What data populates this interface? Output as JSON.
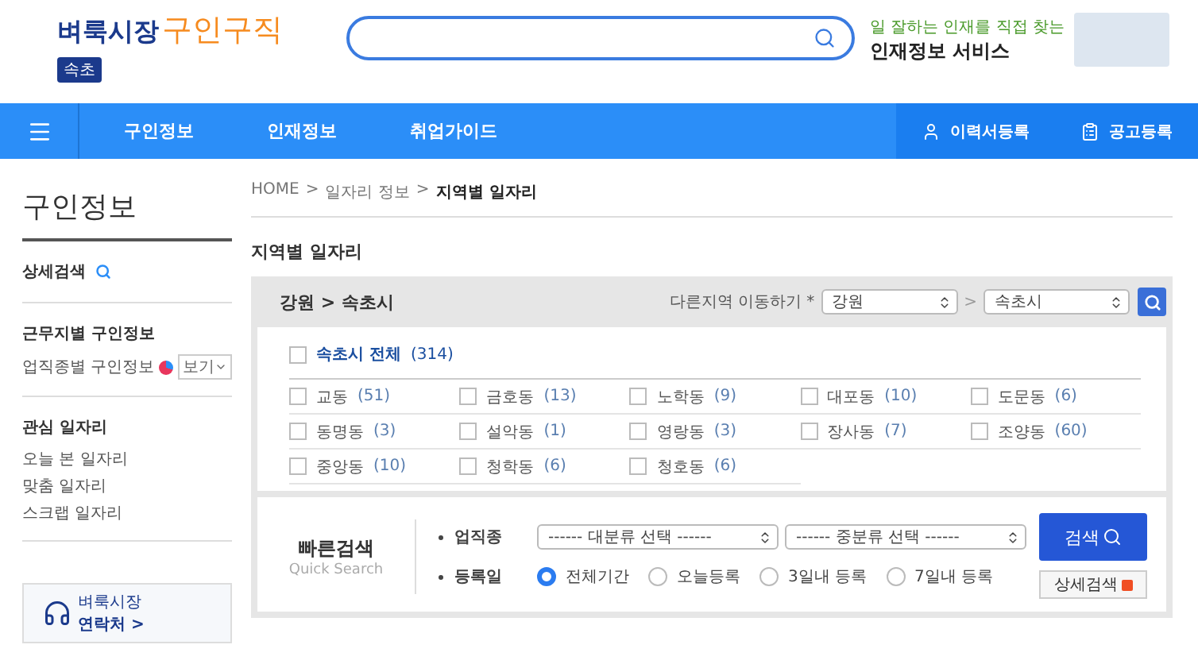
{
  "header": {
    "logo": {
      "brand": "벼룩시장",
      "service": "구인구직"
    },
    "region_badge": "속초",
    "ad": {
      "tagline": "일 잘하는 인재를 직접 찾는",
      "title": "인재정보 서비스"
    }
  },
  "nav": {
    "items": [
      {
        "label": "구인정보"
      },
      {
        "label": "인재정보"
      },
      {
        "label": "취업가이드"
      }
    ],
    "actions": [
      {
        "kind": "person",
        "label": "이력서등록"
      },
      {
        "kind": "notice",
        "label": "공고등록"
      }
    ]
  },
  "sidebar": {
    "title": "구인정보",
    "detail_search": "상세검색",
    "sections": [
      {
        "heading": "근무지별 구인정보",
        "links": [
          {
            "label": "업직종별 구인정보",
            "view": "보기"
          }
        ]
      },
      {
        "heading": "관심 일자리",
        "links": [
          {
            "label": "오늘 본 일자리"
          },
          {
            "label": "맞춤 일자리"
          },
          {
            "label": "스크랩 일자리"
          }
        ]
      }
    ],
    "contact": {
      "brand": "벼룩시장",
      "label": "연락처 >"
    }
  },
  "breadcrumb": [
    {
      "label": "HOME",
      "current": false
    },
    {
      "label": "일자리 정보",
      "current": false
    },
    {
      "label": "지역별 일자리",
      "current": true
    }
  ],
  "page_title": "지역별 일자리",
  "region_panel": {
    "path": "강원 > 속초시",
    "move_label": "다른지역 이동하기 *",
    "province": "강원",
    "separator": ">",
    "city": "속초시"
  },
  "all_option": {
    "label": "속초시 전체",
    "count": "(314)",
    "checked": false
  },
  "districts": [
    {
      "name": "교동",
      "count": "(51)",
      "checked": false
    },
    {
      "name": "금호동",
      "count": "(13)",
      "checked": false
    },
    {
      "name": "노학동",
      "count": "(9)",
      "checked": false
    },
    {
      "name": "대포동",
      "count": "(10)",
      "checked": false
    },
    {
      "name": "도문동",
      "count": "(6)",
      "checked": false
    },
    {
      "name": "동명동",
      "count": "(3)",
      "checked": false
    },
    {
      "name": "설악동",
      "count": "(1)",
      "checked": false
    },
    {
      "name": "영랑동",
      "count": "(3)",
      "checked": false
    },
    {
      "name": "장사동",
      "count": "(7)",
      "checked": false
    },
    {
      "name": "조양동",
      "count": "(60)",
      "checked": false
    },
    {
      "name": "중앙동",
      "count": "(10)",
      "checked": false
    },
    {
      "name": "청학동",
      "count": "(6)",
      "checked": false
    },
    {
      "name": "청호동",
      "count": "(6)",
      "checked": false
    }
  ],
  "quick_search": {
    "title": "빠른검색",
    "subtitle": "Quick Search",
    "job_label": "업직종",
    "job_selects": [
      "------ 대분류 선택 ------",
      "------ 중분류 선택 ------"
    ],
    "date_label": "등록일",
    "date_options": [
      {
        "label": "전체기간",
        "selected": true
      },
      {
        "label": "오늘등록",
        "selected": false
      },
      {
        "label": "3일내 등록",
        "selected": false
      },
      {
        "label": "7일내 등록",
        "selected": false
      }
    ],
    "search_button": "검색",
    "detail_button": "상세검색"
  }
}
